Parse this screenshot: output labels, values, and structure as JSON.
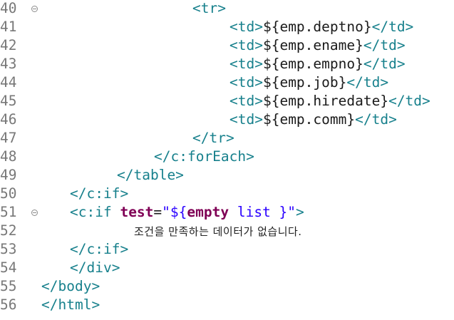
{
  "editor": {
    "lines": [
      {
        "number": "40",
        "folded": true,
        "indent": 270,
        "parts": [
          {
            "t": "<tr>",
            "c": "tag"
          }
        ]
      },
      {
        "number": "41",
        "folded": false,
        "indent": 322,
        "parts": [
          {
            "t": "<td>",
            "c": "tag"
          },
          {
            "t": "${emp.deptno}",
            "c": "el"
          },
          {
            "t": "</td>",
            "c": "tag"
          }
        ]
      },
      {
        "number": "42",
        "folded": false,
        "indent": 322,
        "parts": [
          {
            "t": "<td>",
            "c": "tag"
          },
          {
            "t": "${emp.ename}",
            "c": "el"
          },
          {
            "t": "</td>",
            "c": "tag"
          }
        ]
      },
      {
        "number": "43",
        "folded": false,
        "indent": 322,
        "parts": [
          {
            "t": "<td>",
            "c": "tag"
          },
          {
            "t": "${emp.empno}",
            "c": "el"
          },
          {
            "t": "</td>",
            "c": "tag"
          }
        ]
      },
      {
        "number": "44",
        "folded": false,
        "indent": 322,
        "parts": [
          {
            "t": "<td>",
            "c": "tag"
          },
          {
            "t": "${emp.job}",
            "c": "el"
          },
          {
            "t": "</td>",
            "c": "tag"
          }
        ]
      },
      {
        "number": "45",
        "folded": false,
        "indent": 322,
        "parts": [
          {
            "t": "<td>",
            "c": "tag"
          },
          {
            "t": "${emp.hiredate}",
            "c": "el"
          },
          {
            "t": "</td>",
            "c": "tag"
          }
        ]
      },
      {
        "number": "46",
        "folded": false,
        "indent": 322,
        "parts": [
          {
            "t": "<td>",
            "c": "tag"
          },
          {
            "t": "${emp.comm}",
            "c": "el"
          },
          {
            "t": "</td>",
            "c": "tag"
          }
        ]
      },
      {
        "number": "47",
        "folded": false,
        "indent": 270,
        "parts": [
          {
            "t": "</tr>",
            "c": "tag"
          }
        ]
      },
      {
        "number": "48",
        "folded": false,
        "indent": 216,
        "parts": [
          {
            "t": "</c:forEach>",
            "c": "tag"
          }
        ]
      },
      {
        "number": "49",
        "folded": false,
        "indent": 164,
        "parts": [
          {
            "t": "</table>",
            "c": "tag"
          }
        ]
      },
      {
        "number": "50",
        "folded": false,
        "indent": 98,
        "parts": [
          {
            "t": "</c:if>",
            "c": "tag"
          }
        ]
      },
      {
        "number": "51",
        "folded": true,
        "indent": 98,
        "parts": [
          {
            "t": "<c:if ",
            "c": "tag"
          },
          {
            "t": "test",
            "c": "attr"
          },
          {
            "t": "=",
            "c": "el"
          },
          {
            "t": "\"${",
            "c": "str"
          },
          {
            "t": "empty",
            "c": "attr"
          },
          {
            "t": " list }\"",
            "c": "str"
          },
          {
            "t": ">",
            "c": "tag"
          }
        ]
      },
      {
        "number": "52",
        "folded": false,
        "indent": 188,
        "parts": [
          {
            "t": "조건을 만족하는 데이터가 없습니다.",
            "c": "kr"
          }
        ]
      },
      {
        "number": "53",
        "folded": false,
        "indent": 98,
        "parts": [
          {
            "t": "</c:if>",
            "c": "tag"
          }
        ]
      },
      {
        "number": "54",
        "folded": false,
        "indent": 98,
        "parts": [
          {
            "t": "</div>",
            "c": "tag"
          }
        ]
      },
      {
        "number": "55",
        "folded": false,
        "indent": 58,
        "parts": [
          {
            "t": "</body>",
            "c": "tag"
          }
        ]
      },
      {
        "number": "56",
        "folded": false,
        "indent": 58,
        "parts": [
          {
            "t": "</html>",
            "c": "tag"
          }
        ]
      }
    ]
  },
  "colors": {
    "background": "#ffffff",
    "line_number": "#787878",
    "tag": "#17808c",
    "keyword": "#7f0055",
    "string": "#2a00ff",
    "text": "#1a1a1a"
  }
}
